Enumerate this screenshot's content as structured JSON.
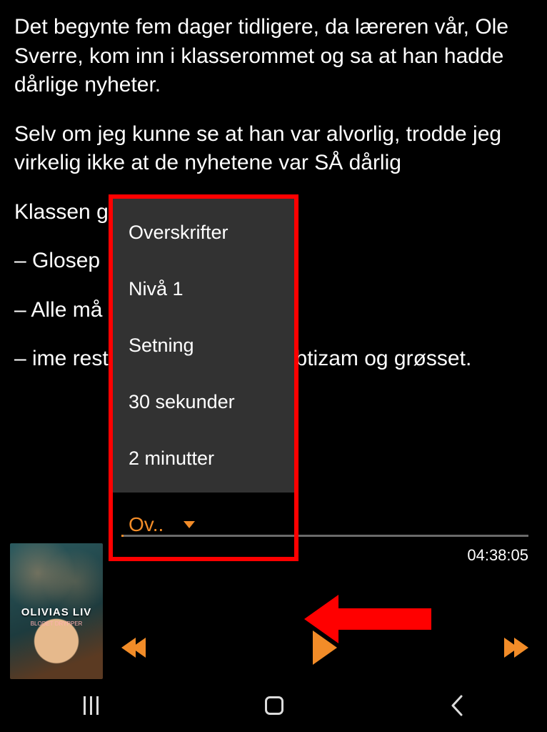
{
  "paragraphs": [
    "Det begynte fem dager tidligere, da læreren vår, Ole Sverre, kom inn i klasserommet og sa at han hadde dårlige nyheter.",
    "Selv om jeg kunne se at han var alvorlig, trodde jeg virkelig ikke at de nyhetene var SÅ dårlig",
    "Klassen g                              g med å gjette:",
    "– Glosep",
    "– Alle må                               slo Vanja.",
    "             –                              ime resten av barnesko                            sa Ibtizam og grøsset."
  ],
  "popup": {
    "items": [
      "Overskrifter",
      "Nivå 1",
      "Setning",
      "30 sekunder",
      "2 minutter"
    ],
    "selected_abbrev": "Ov.."
  },
  "player": {
    "cover_title": "OLIVIAS LIV",
    "cover_subtitle": "BLODET DRYPPER",
    "time_total": "04:38:05"
  }
}
